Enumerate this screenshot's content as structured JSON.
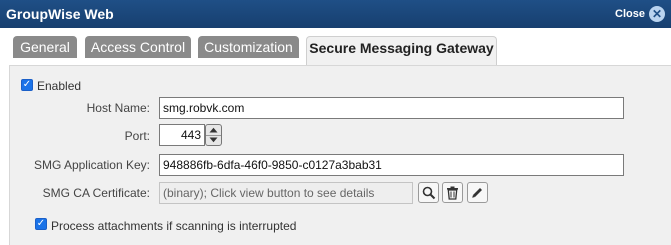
{
  "window": {
    "title": "GroupWise Web",
    "close_label": "Close",
    "close_icon": "close-icon"
  },
  "tabs": [
    {
      "label": "General",
      "active": false
    },
    {
      "label": "Access Control",
      "active": false
    },
    {
      "label": "Customization",
      "active": false
    },
    {
      "label": "Secure Messaging Gateway",
      "active": true
    }
  ],
  "form": {
    "enabled": {
      "label": "Enabled",
      "checked": true
    },
    "host_name": {
      "label": "Host Name:",
      "value": "smg.robvk.com"
    },
    "port": {
      "label": "Port:",
      "value": "443"
    },
    "app_key": {
      "label": "SMG Application Key:",
      "value": "948886fb-6dfa-46f0-9850-c0127a3bab31"
    },
    "ca_cert": {
      "label": "SMG CA Certificate:",
      "value": "(binary); Click view button to see details",
      "icons": [
        "view-icon",
        "delete-icon",
        "edit-icon"
      ]
    },
    "process_attachments": {
      "label": "Process attachments if scanning is interrupted",
      "checked": true
    }
  },
  "colors": {
    "titlebar": "#1f4f86",
    "tab_inactive": "#8a8a8a",
    "checkbox_accent": "#1a73e8"
  }
}
